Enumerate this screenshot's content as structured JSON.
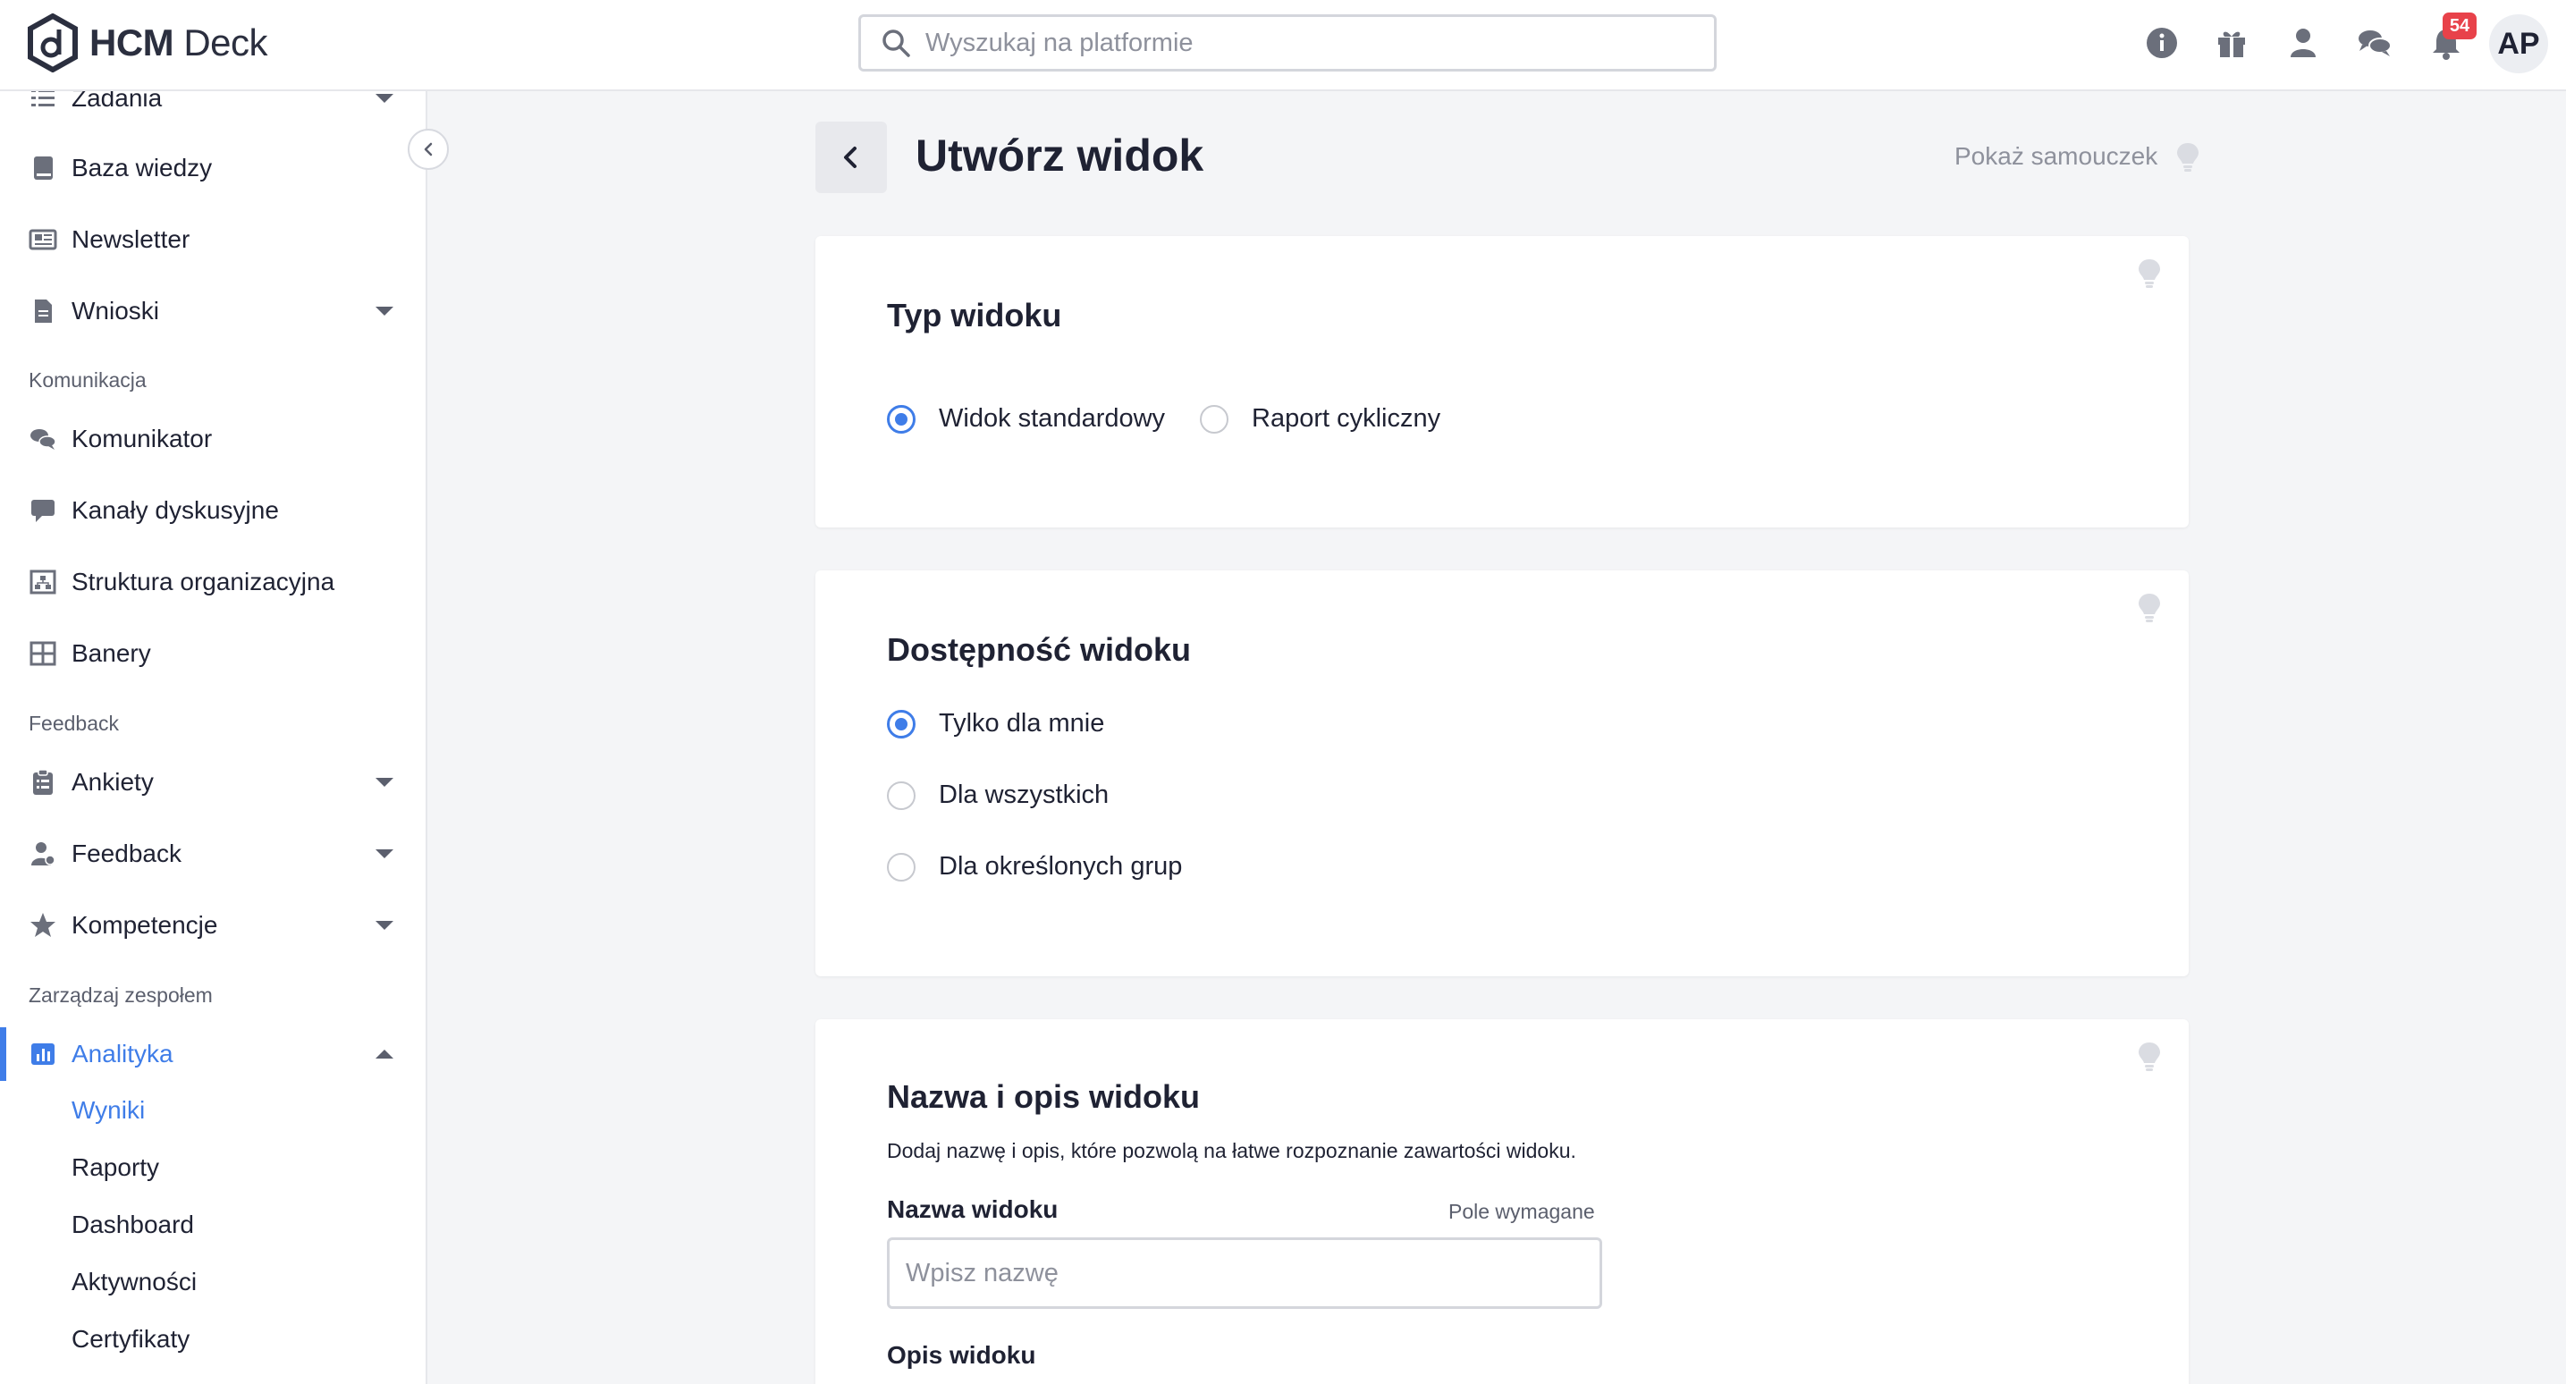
{
  "header": {
    "logo_text_bold": "HCM",
    "logo_text_light": " Deck",
    "search_placeholder": "Wyszukaj na platformie",
    "notification_count": "54",
    "avatar_initials": "AP"
  },
  "sidebar": {
    "items_top": [
      {
        "label": "Zadania",
        "icon": "tasks-icon"
      },
      {
        "label": "Baza wiedzy",
        "icon": "book-icon"
      },
      {
        "label": "Newsletter",
        "icon": "newspaper-icon"
      },
      {
        "label": "Wnioski",
        "icon": "document-icon"
      }
    ],
    "section_komunikacja": "Komunikacja",
    "items_komunikacja": [
      {
        "label": "Komunikator",
        "icon": "chat-icon"
      },
      {
        "label": "Kanały dyskusyjne",
        "icon": "comment-icon"
      },
      {
        "label": "Struktura organizacyjna",
        "icon": "org-structure-icon"
      },
      {
        "label": "Banery",
        "icon": "grid-icon"
      }
    ],
    "section_feedback": "Feedback",
    "items_feedback": [
      {
        "label": "Ankiety",
        "icon": "clipboard-icon"
      },
      {
        "label": "Feedback",
        "icon": "user-feedback-icon"
      },
      {
        "label": "Kompetencje",
        "icon": "star-icon"
      }
    ],
    "section_team": "Zarządzaj zespołem",
    "active_item": {
      "label": "Analityka",
      "icon": "chart-icon"
    },
    "subitems": [
      "Wyniki",
      "Raporty",
      "Dashboard",
      "Aktywności",
      "Certyfikaty"
    ]
  },
  "main": {
    "title": "Utwórz widok",
    "tutorial_label": "Pokaż samouczek",
    "card_type": {
      "title": "Typ widoku",
      "options": [
        "Widok standardowy",
        "Raport cykliczny"
      ],
      "selected": 0
    },
    "card_access": {
      "title": "Dostępność widoku",
      "options": [
        "Tylko dla mnie",
        "Dla wszystkich",
        "Dla określonych grup"
      ],
      "selected": 0
    },
    "card_name": {
      "title": "Nazwa i opis widoku",
      "description": "Dodaj nazwę i opis, które pozwolą na łatwe rozpoznanie zawartości widoku.",
      "name_label": "Nazwa widoku",
      "required_label": "Pole wymagane",
      "name_placeholder": "Wpisz nazwę",
      "desc_label": "Opis widoku"
    }
  },
  "colors": {
    "accent": "#3f7de8",
    "badge": "#e8424a",
    "background": "#f4f5f7"
  }
}
